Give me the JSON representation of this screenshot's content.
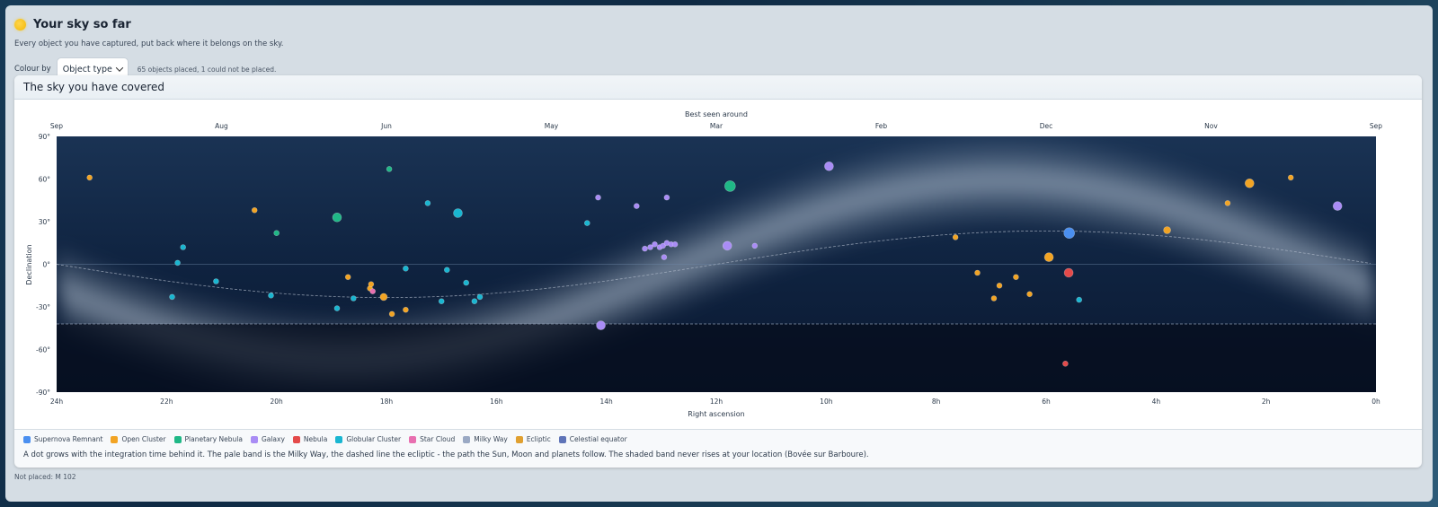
{
  "header": {
    "title": "Your sky so far",
    "subtitle": "Every object you have captured, put back where it belongs on the sky.",
    "colour_by_label": "Colour by",
    "colour_by_value": "Object type",
    "summary": "65 objects placed, 1 could not be placed."
  },
  "card": {
    "title": "The sky you have covered",
    "caption": "A dot grows with the integration time behind it. The pale band is the Milky Way, the dashed line the ecliptic - the path the Sun, Moon and planets follow. The shaded band never rises at your location (Bovée sur Barboure)."
  },
  "footer": {
    "not_placed": "Not placed: M 102"
  },
  "colors": {
    "Supernova Remnant": "#4a8ff0",
    "Open Cluster": "#f2a424",
    "Planetary Nebula": "#1fb886",
    "Galaxy": "#a98cf5",
    "Nebula": "#e44a4a",
    "Globular Cluster": "#19b6d1",
    "Star Cloud": "#e86fb0",
    "Milky Way": "#9aa9c4",
    "Ecliptic": "#e0a030",
    "Celestial equator": "#5f74b8"
  },
  "chart_data": {
    "type": "scatter",
    "title": "",
    "xlabel": "Right ascension",
    "ylabel": "Declination",
    "top_axis_label": "Best seen around",
    "xlim": [
      24,
      0
    ],
    "ylim": [
      -90,
      90
    ],
    "x_ticks": [
      "24h",
      "22h",
      "20h",
      "18h",
      "16h",
      "14h",
      "12h",
      "10h",
      "8h",
      "6h",
      "4h",
      "2h",
      "0h"
    ],
    "y_ticks": [
      "90°",
      "60°",
      "30°",
      "0°",
      "-30°",
      "-60°",
      "-90°"
    ],
    "top_ticks": [
      "Sep",
      "Aug",
      "Jun",
      "May",
      "Mar",
      "Feb",
      "Dec",
      "Nov",
      "Sep"
    ],
    "horizon_limit_dec": -42,
    "legend": [
      "Supernova Remnant",
      "Open Cluster",
      "Planetary Nebula",
      "Galaxy",
      "Nebula",
      "Globular Cluster",
      "Star Cloud",
      "Milky Way",
      "Ecliptic",
      "Celestial equator"
    ],
    "points": [
      {
        "ra": 23.4,
        "dec": 61,
        "type": "Open Cluster",
        "size": 3
      },
      {
        "ra": 21.7,
        "dec": 12,
        "type": "Globular Cluster",
        "size": 3
      },
      {
        "ra": 21.8,
        "dec": 1,
        "type": "Globular Cluster",
        "size": 3
      },
      {
        "ra": 21.9,
        "dec": -23,
        "type": "Globular Cluster",
        "size": 3
      },
      {
        "ra": 21.1,
        "dec": -12,
        "type": "Globular Cluster",
        "size": 3
      },
      {
        "ra": 20.4,
        "dec": 38,
        "type": "Open Cluster",
        "size": 3
      },
      {
        "ra": 20.0,
        "dec": 22,
        "type": "Planetary Nebula",
        "size": 3
      },
      {
        "ra": 20.1,
        "dec": -22,
        "type": "Globular Cluster",
        "size": 3
      },
      {
        "ra": 18.9,
        "dec": 33,
        "type": "Planetary Nebula",
        "size": 5
      },
      {
        "ra": 18.9,
        "dec": -31,
        "type": "Globular Cluster",
        "size": 3
      },
      {
        "ra": 18.6,
        "dec": -24,
        "type": "Globular Cluster",
        "size": 3
      },
      {
        "ra": 18.7,
        "dec": -9,
        "type": "Open Cluster",
        "size": 3
      },
      {
        "ra": 18.3,
        "dec": -17,
        "type": "Open Cluster",
        "size": 3
      },
      {
        "ra": 18.28,
        "dec": -14,
        "type": "Open Cluster",
        "size": 3
      },
      {
        "ra": 18.25,
        "dec": -19,
        "type": "Star Cloud",
        "size": 3
      },
      {
        "ra": 18.05,
        "dec": -23,
        "type": "Open Cluster",
        "size": 4
      },
      {
        "ra": 17.9,
        "dec": -35,
        "type": "Open Cluster",
        "size": 3
      },
      {
        "ra": 17.95,
        "dec": 67,
        "type": "Planetary Nebula",
        "size": 3
      },
      {
        "ra": 17.65,
        "dec": -3,
        "type": "Globular Cluster",
        "size": 3
      },
      {
        "ra": 17.65,
        "dec": -32,
        "type": "Open Cluster",
        "size": 3
      },
      {
        "ra": 17.25,
        "dec": 43,
        "type": "Globular Cluster",
        "size": 3
      },
      {
        "ra": 17.0,
        "dec": -26,
        "type": "Globular Cluster",
        "size": 3
      },
      {
        "ra": 16.9,
        "dec": -4,
        "type": "Globular Cluster",
        "size": 3
      },
      {
        "ra": 16.7,
        "dec": 36,
        "type": "Globular Cluster",
        "size": 5
      },
      {
        "ra": 16.55,
        "dec": -13,
        "type": "Globular Cluster",
        "size": 3
      },
      {
        "ra": 16.4,
        "dec": -26,
        "type": "Globular Cluster",
        "size": 3
      },
      {
        "ra": 16.3,
        "dec": -23,
        "type": "Globular Cluster",
        "size": 3
      },
      {
        "ra": 14.15,
        "dec": 47,
        "type": "Galaxy",
        "size": 3
      },
      {
        "ra": 14.35,
        "dec": 29,
        "type": "Globular Cluster",
        "size": 3
      },
      {
        "ra": 13.45,
        "dec": 41,
        "type": "Galaxy",
        "size": 3
      },
      {
        "ra": 12.9,
        "dec": 47,
        "type": "Galaxy",
        "size": 3
      },
      {
        "ra": 14.1,
        "dec": -43,
        "type": "Galaxy",
        "size": 5
      },
      {
        "ra": 13.3,
        "dec": 11,
        "type": "Galaxy",
        "size": 3
      },
      {
        "ra": 13.2,
        "dec": 12,
        "type": "Galaxy",
        "size": 3
      },
      {
        "ra": 13.12,
        "dec": 14,
        "type": "Galaxy",
        "size": 3
      },
      {
        "ra": 13.03,
        "dec": 12,
        "type": "Galaxy",
        "size": 3
      },
      {
        "ra": 12.97,
        "dec": 13,
        "type": "Galaxy",
        "size": 3
      },
      {
        "ra": 12.9,
        "dec": 15,
        "type": "Galaxy",
        "size": 3
      },
      {
        "ra": 12.82,
        "dec": 14,
        "type": "Galaxy",
        "size": 3
      },
      {
        "ra": 12.75,
        "dec": 14,
        "type": "Galaxy",
        "size": 3
      },
      {
        "ra": 12.95,
        "dec": 5,
        "type": "Galaxy",
        "size": 3
      },
      {
        "ra": 11.75,
        "dec": 55,
        "type": "Planetary Nebula",
        "size": 6
      },
      {
        "ra": 11.8,
        "dec": 13,
        "type": "Galaxy",
        "size": 5
      },
      {
        "ra": 11.3,
        "dec": 13,
        "type": "Galaxy",
        "size": 3
      },
      {
        "ra": 9.95,
        "dec": 69,
        "type": "Galaxy",
        "size": 5
      },
      {
        "ra": 7.65,
        "dec": 19,
        "type": "Open Cluster",
        "size": 3
      },
      {
        "ra": 7.25,
        "dec": -6,
        "type": "Open Cluster",
        "size": 3
      },
      {
        "ra": 6.85,
        "dec": -15,
        "type": "Open Cluster",
        "size": 3
      },
      {
        "ra": 6.95,
        "dec": -24,
        "type": "Open Cluster",
        "size": 3
      },
      {
        "ra": 6.55,
        "dec": -9,
        "type": "Open Cluster",
        "size": 3
      },
      {
        "ra": 6.3,
        "dec": -21,
        "type": "Open Cluster",
        "size": 3
      },
      {
        "ra": 5.95,
        "dec": 5,
        "type": "Open Cluster",
        "size": 5
      },
      {
        "ra": 5.58,
        "dec": 22,
        "type": "Supernova Remnant",
        "size": 6
      },
      {
        "ra": 5.59,
        "dec": -6,
        "type": "Nebula",
        "size": 5
      },
      {
        "ra": 5.65,
        "dec": -70,
        "type": "Nebula",
        "size": 3
      },
      {
        "ra": 5.4,
        "dec": -25,
        "type": "Globular Cluster",
        "size": 3
      },
      {
        "ra": 3.8,
        "dec": 24,
        "type": "Open Cluster",
        "size": 4
      },
      {
        "ra": 2.7,
        "dec": 43,
        "type": "Open Cluster",
        "size": 3
      },
      {
        "ra": 2.3,
        "dec": 57,
        "type": "Open Cluster",
        "size": 5
      },
      {
        "ra": 1.55,
        "dec": 61,
        "type": "Open Cluster",
        "size": 3
      },
      {
        "ra": 0.7,
        "dec": 41,
        "type": "Galaxy",
        "size": 5
      }
    ]
  }
}
